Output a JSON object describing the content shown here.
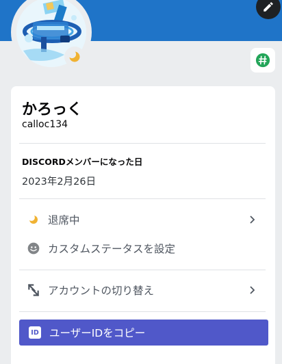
{
  "profile": {
    "display_name": "かろっく",
    "username": "calloc134"
  },
  "member_since": {
    "title": "DISCORDメンバーになった日",
    "date": "2023年2月26日"
  },
  "menu": {
    "status_label": "退席中",
    "custom_status_label": "カスタムステータスを設定",
    "switch_account_label": "アカウントの切り替え",
    "copy_id_label": "ユーザーIDをコピー",
    "copy_id_icon_text": "ID"
  },
  "colors": {
    "banner": "#1f74c8",
    "accent_button": "#5058c9",
    "idle_status": "#f0b232",
    "hash_badge": "#23a559"
  },
  "icons": {
    "edit": "pencil-icon",
    "status": "crescent-moon-icon",
    "custom_status": "emoji-face-icon",
    "switch_account": "switch-arrows-icon",
    "copy_id": "id-badge-icon",
    "hash_badge": "hashtag-icon",
    "chevron": "chevron-right-icon"
  }
}
